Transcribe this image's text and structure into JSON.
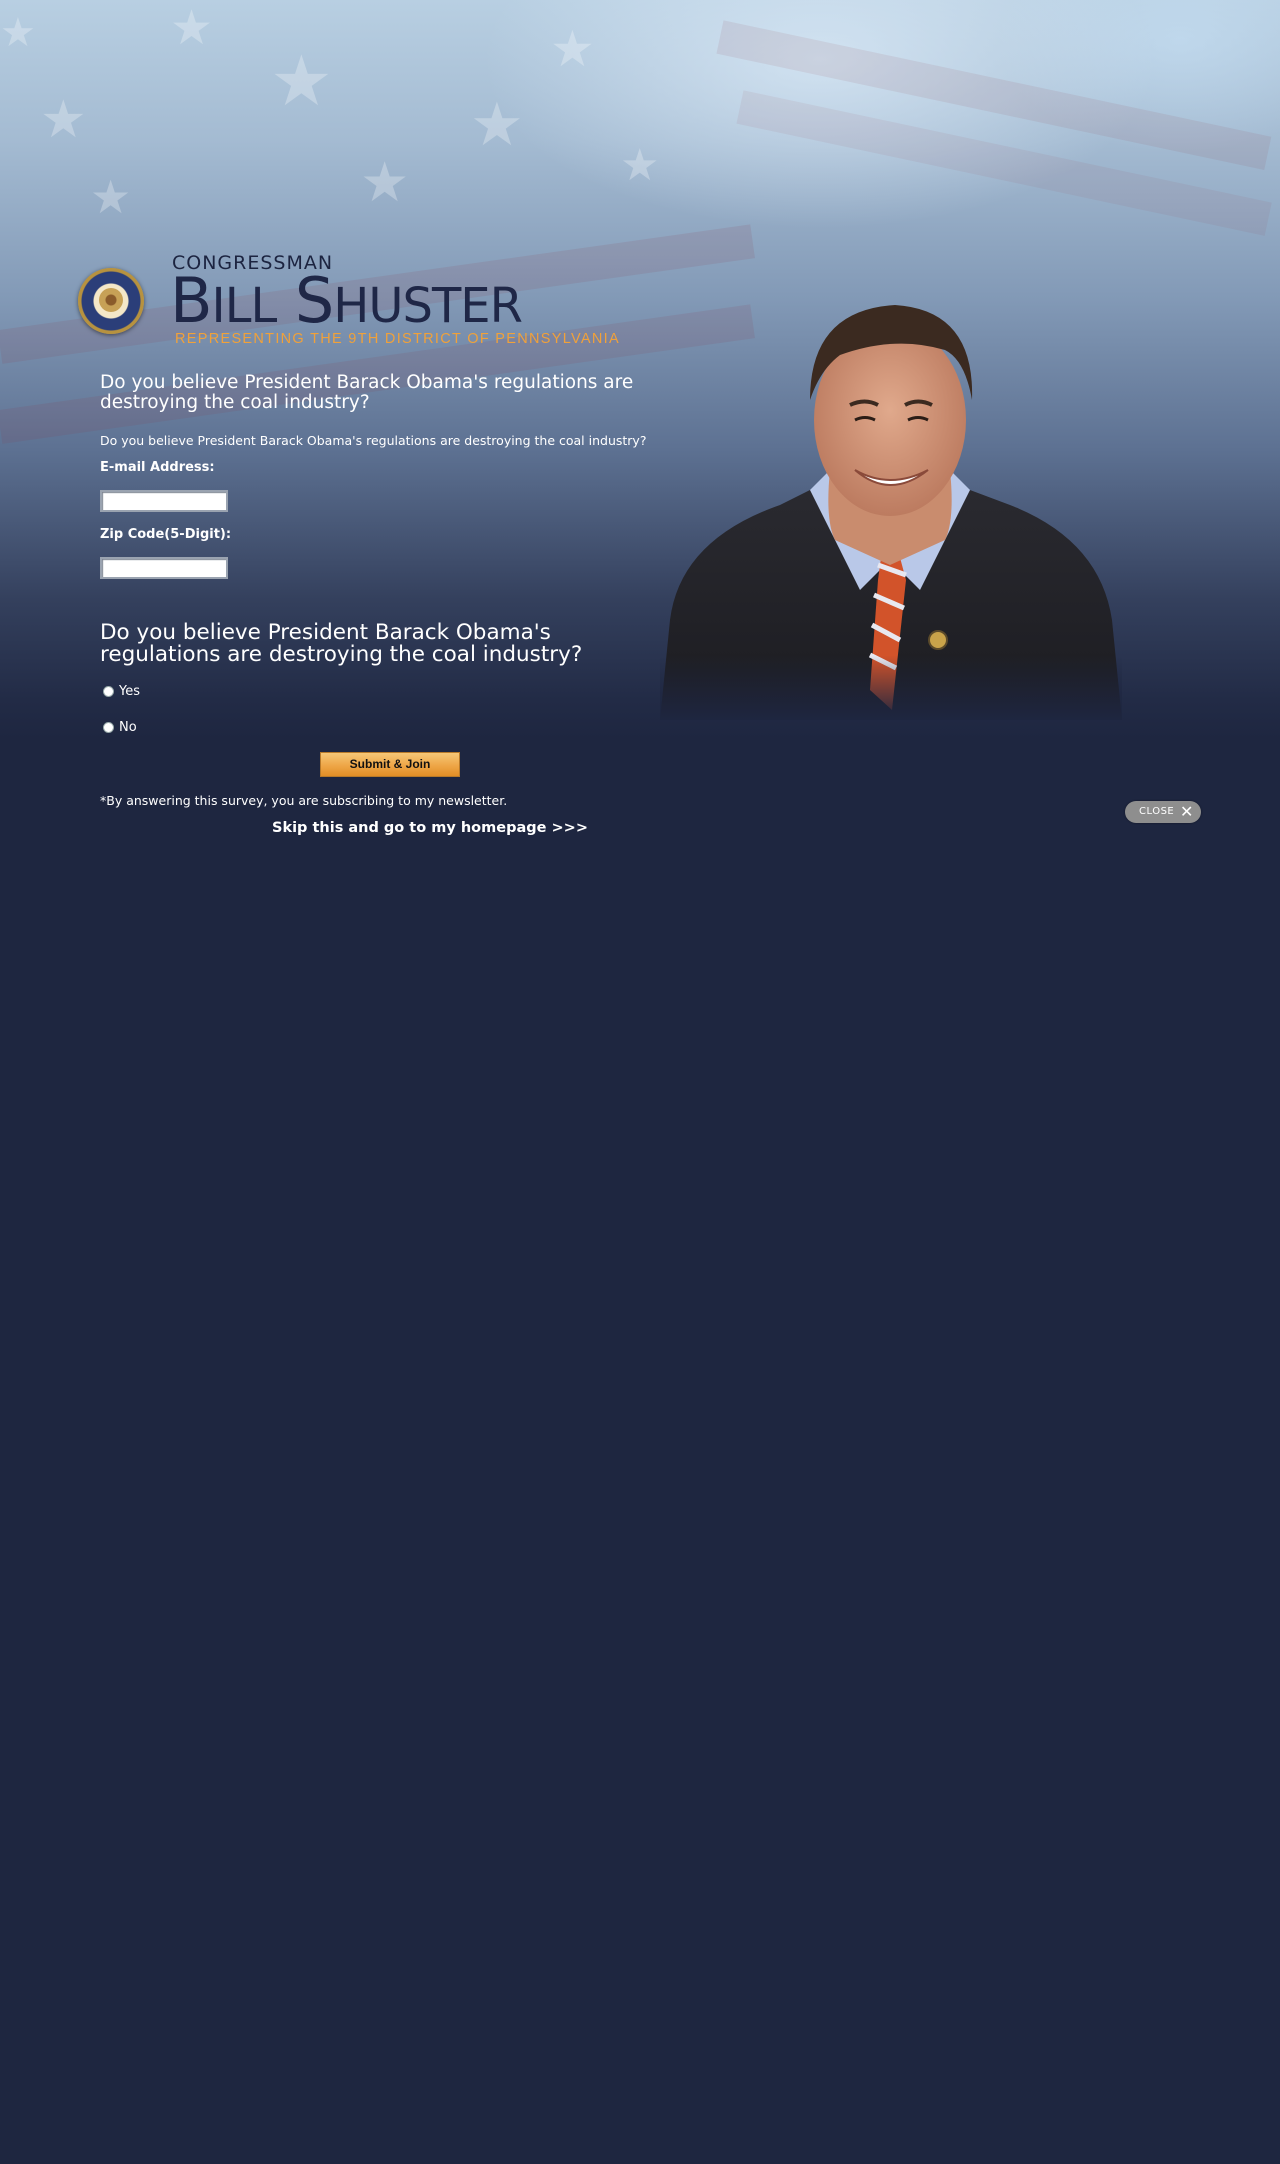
{
  "header": {
    "title_prefix": "CONGRESSMAN",
    "name_part1_big": "B",
    "name_part1_small": "ILL",
    "name_part2_big": "S",
    "name_part2_small": "HUSTER",
    "district": "REPRESENTING THE 9TH DISTRICT OF PENNSYLVANIA",
    "seal_alt": "United States Congress seal"
  },
  "survey": {
    "headline": "Do you believe President Barack Obama's regulations are destroying the coal industry?",
    "subtext": "Do you believe President Barack Obama's regulations are destroying the coal industry?",
    "email_label": "E-mail Address:",
    "email_value": "",
    "zip_label": "Zip Code(5-Digit):",
    "zip_value": "",
    "question": "Do you believe President Barack Obama's regulations are destroying the coal industry?",
    "options": [
      {
        "label": "Yes",
        "selected": false
      },
      {
        "label": "No",
        "selected": false
      }
    ],
    "submit_label": "Submit & Join",
    "disclaimer": "*By answering this survey, you are subscribing to my newsletter.",
    "skip_link": "Skip this and go to my homepage >>>"
  },
  "modal": {
    "close_label": "CLOSE",
    "close_icon": "close-x-icon"
  },
  "colors": {
    "background": "#1e2640",
    "accent_orange": "#f0a13a",
    "name_color": "#1f2747"
  }
}
